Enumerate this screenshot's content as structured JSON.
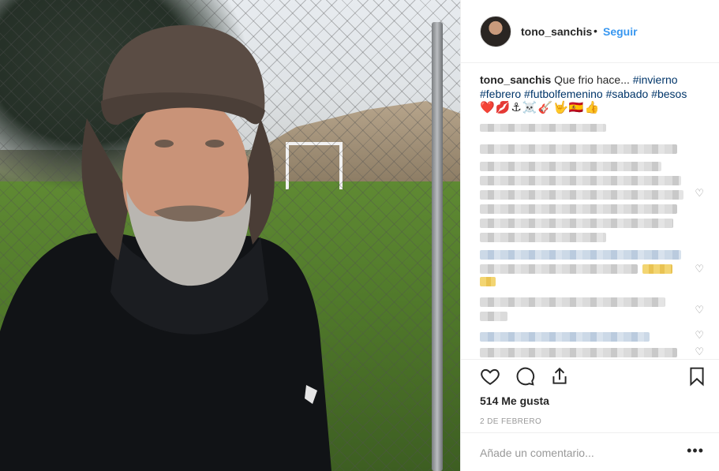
{
  "post": {
    "username": "tono_sanchis",
    "follow_label": "Seguir",
    "separator": "•",
    "caption_user": "tono_sanchis",
    "caption_text": " Que frio hace... ",
    "tags": [
      "#invierno",
      "#febrero",
      "#futbolfemenino",
      "#sabado",
      "#besos"
    ],
    "emojis": "❤️💋⚓☠️🎸🤟🇪🇸👍",
    "likes": "514 Me gusta",
    "date": "2 de febrero",
    "add_comment_placeholder": "Añade un comentario...",
    "more_label": "•••"
  },
  "icons": {
    "like": "heart-icon",
    "comment": "comment-icon",
    "share": "share-icon",
    "save": "bookmark-icon",
    "comment_like": "heart-icon"
  },
  "colors": {
    "accent": "#3897f0",
    "hashtag": "#003569",
    "muted": "#999999"
  }
}
